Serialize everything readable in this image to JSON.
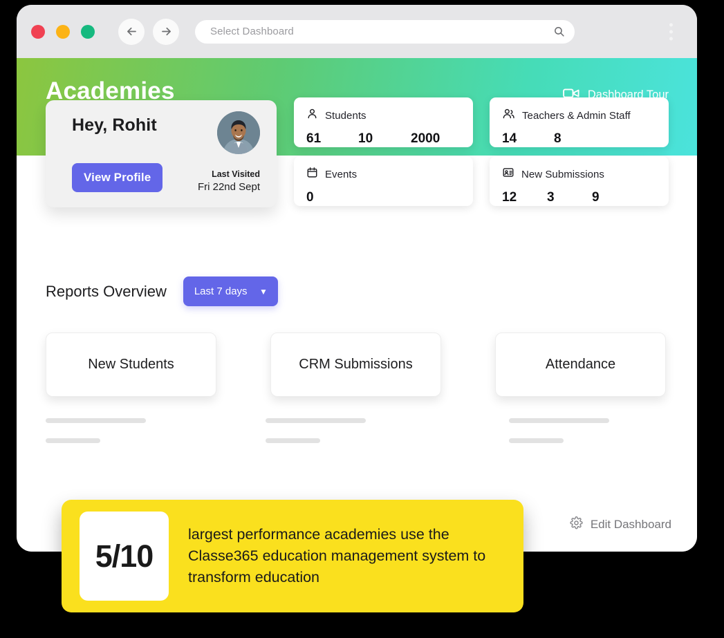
{
  "browser": {
    "traffic_lights": [
      "close",
      "minimize",
      "maximize"
    ],
    "back_icon": "arrow-left-icon",
    "forward_icon": "arrow-right-icon",
    "address_placeholder": "Select Dashboard",
    "address_value": "",
    "search_icon": "search-icon",
    "menu_icon": "kebab-menu-icon"
  },
  "banner": {
    "title": "Academies",
    "tour_label": "Dashboard Tour",
    "tour_icon": "video-camera-icon",
    "gradient_start": "#8cc63f",
    "gradient_end": "#4be3dc"
  },
  "profile": {
    "greeting": "Hey, Rohit",
    "button_label": "View Profile",
    "last_visited_label": "Last Visited",
    "last_visited_value": "Fri 22nd Sept",
    "avatar_alt": "user-avatar",
    "accent": "#6366e8"
  },
  "stats": [
    {
      "id": "students",
      "icon": "person-icon",
      "label": "Students",
      "values": [
        "61",
        "10",
        "2000"
      ]
    },
    {
      "id": "teachers",
      "icon": "people-icon",
      "label": "Teachers & Admin Staff",
      "values": [
        "14",
        "8"
      ]
    },
    {
      "id": "events",
      "icon": "calendar-icon",
      "label": "Events",
      "values": [
        "0"
      ]
    },
    {
      "id": "submissions",
      "icon": "id-card-icon",
      "label": "New Submissions",
      "values": [
        "12",
        "3",
        "9"
      ]
    }
  ],
  "reports": {
    "title": "Reports Overview",
    "range_value": "Last 7 days",
    "range_caret": "▼",
    "cards": [
      {
        "label": "New Students"
      },
      {
        "label": "CRM Submissions"
      },
      {
        "label": "Attendance"
      }
    ]
  },
  "footer": {
    "edit_label": "Edit Dashboard",
    "edit_icon": "gear-icon"
  },
  "callout": {
    "badge": "5/10",
    "text": "largest performance academies use the Classe365 education management system to transform education",
    "background": "#fae01e"
  }
}
